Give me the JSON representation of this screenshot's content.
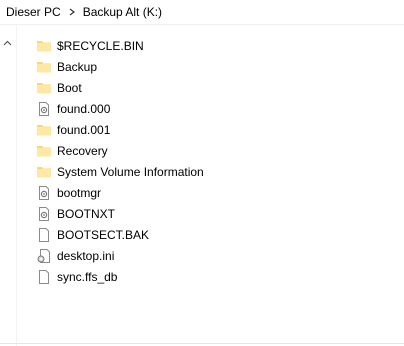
{
  "breadcrumb": {
    "root": "Dieser PC",
    "current": "Backup Alt (K:)"
  },
  "colors": {
    "folder": "#ffe8a3",
    "folder_dark": "#f2c94c",
    "file_border": "#9a9a9a"
  },
  "files": [
    {
      "name": "$RECYCLE.BIN",
      "icon": "folder-icon"
    },
    {
      "name": "Backup",
      "icon": "folder-icon"
    },
    {
      "name": "Boot",
      "icon": "folder-icon"
    },
    {
      "name": "found.000",
      "icon": "system-file-icon"
    },
    {
      "name": "found.001",
      "icon": "folder-icon"
    },
    {
      "name": "Recovery",
      "icon": "folder-icon"
    },
    {
      "name": "System Volume Information",
      "icon": "folder-icon"
    },
    {
      "name": "bootmgr",
      "icon": "system-file-icon"
    },
    {
      "name": "BOOTNXT",
      "icon": "system-file-icon"
    },
    {
      "name": "BOOTSECT.BAK",
      "icon": "file-icon"
    },
    {
      "name": "desktop.ini",
      "icon": "settings-file-icon"
    },
    {
      "name": "sync.ffs_db",
      "icon": "file-icon"
    }
  ]
}
